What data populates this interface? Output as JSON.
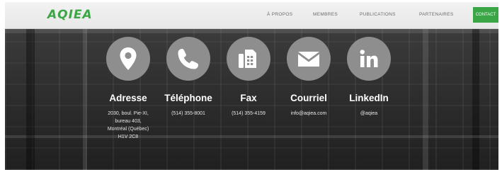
{
  "header": {
    "logo": "AQIEA",
    "nav": [
      {
        "label": "À PROPOS"
      },
      {
        "label": "MEMBRES"
      },
      {
        "label": "PUBLICATIONS"
      },
      {
        "label": "PARTENAIRES"
      }
    ],
    "contact_label": "CONTACT",
    "accent_color": "#3aa645"
  },
  "contacts": [
    {
      "icon": "map-pin-icon",
      "title": "Adresse",
      "lines": [
        "2030, boul. Pie-XI,",
        "bureau 403,",
        "Montréal (Québec)",
        "H1V 2C8"
      ]
    },
    {
      "icon": "phone-icon",
      "title": "Téléphone",
      "lines": [
        "(514) 355-8001"
      ]
    },
    {
      "icon": "fax-icon",
      "title": "Fax",
      "lines": [
        "(514) 355-4159"
      ]
    },
    {
      "icon": "envelope-icon",
      "title": "Courriel",
      "lines": [
        "info@aqiea.com"
      ]
    },
    {
      "icon": "linkedin-icon",
      "title": "LinkedIn",
      "lines": [
        "@aqiea"
      ]
    }
  ]
}
